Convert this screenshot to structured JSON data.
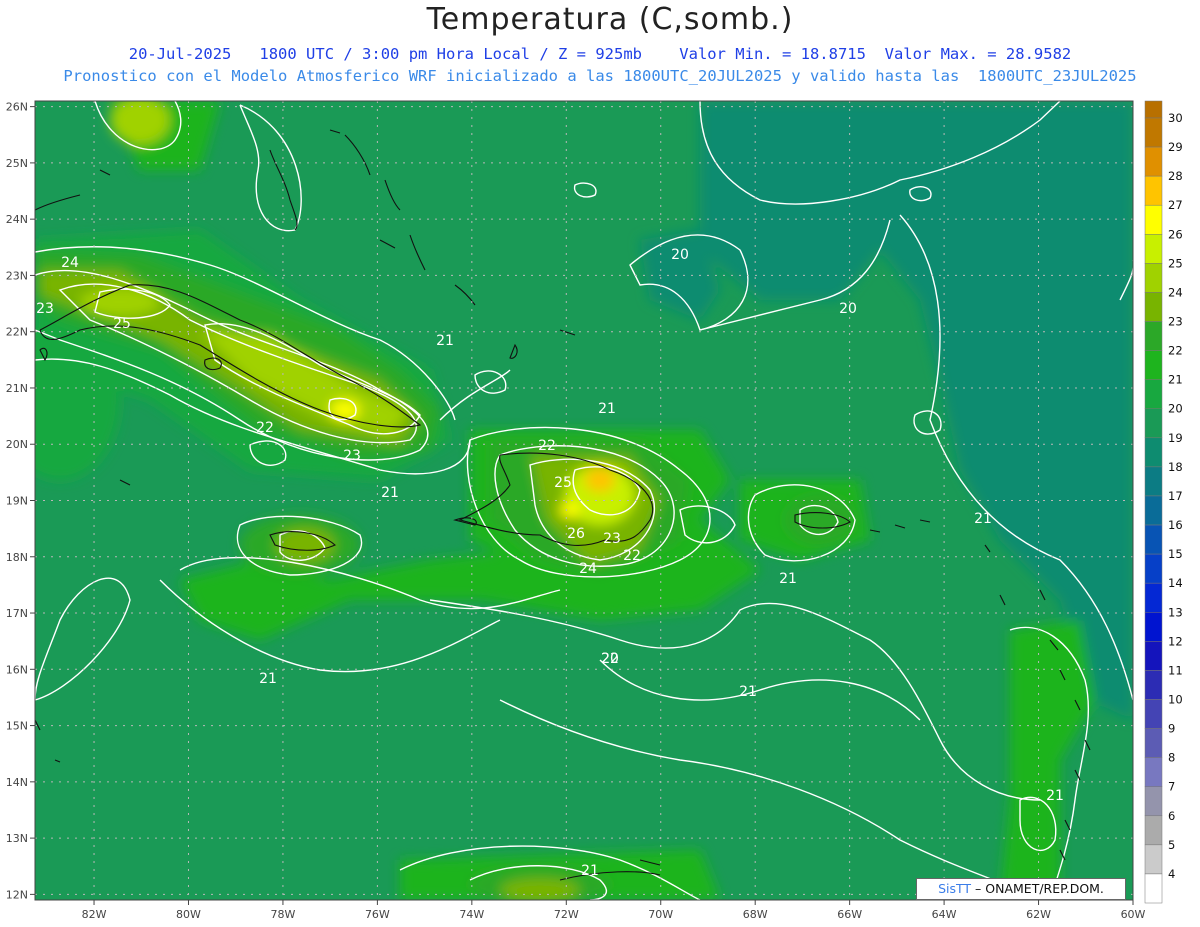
{
  "header": {
    "title": "Temperatura (C,somb.)",
    "subtitle1": "20-Jul-2025   1800 UTC / 3:00 pm Hora Local / Z = 925mb    Valor Min. = 18.8715  Valor Max. = 28.9582",
    "subtitle2": "Pronostico con el Modelo Atmosferico WRF inicializado a las 1800UTC_20JUL2025 y valido hasta las  1800UTC_23JUL2025"
  },
  "map": {
    "lon_range": [
      -83.25,
      -60
    ],
    "lat_range": [
      11.9,
      26.1
    ],
    "lon_ticks": [
      "82W",
      "80W",
      "78W",
      "76W",
      "74W",
      "72W",
      "70W",
      "68W",
      "66W",
      "64W",
      "62W",
      "60W"
    ],
    "lat_ticks": [
      "12N",
      "13N",
      "14N",
      "15N",
      "16N",
      "17N",
      "18N",
      "19N",
      "20N",
      "21N",
      "22N",
      "23N",
      "24N",
      "25N",
      "26N"
    ],
    "value_range": {
      "min": 18.8715,
      "max": 28.9582
    },
    "contour_labels": [
      "24",
      "23",
      "25",
      "21",
      "22",
      "23",
      "21",
      "21",
      "21",
      "20",
      "20",
      "21",
      "22",
      "25",
      "26",
      "23",
      "24",
      "22",
      "21",
      "20",
      "21",
      "21",
      "21",
      "22"
    ]
  },
  "colorbar": {
    "labels": [
      "30",
      "29",
      "28",
      "27",
      "26",
      "25",
      "24",
      "23",
      "22",
      "21",
      "20",
      "19",
      "18",
      "17",
      "16",
      "15",
      "14",
      "13",
      "12",
      "11",
      "10",
      "9",
      "8",
      "7",
      "6",
      "5",
      "4"
    ],
    "colors": [
      "#c07800",
      "#e09000",
      "#ffc400",
      "#ffff00",
      "#c8f000",
      "#a0d200",
      "#78b400",
      "#2ca828",
      "#1eb41e",
      "#18a840",
      "#1a9a56",
      "#0e8c70",
      "#0c7c84",
      "#0a6c98",
      "#0854b4",
      "#0640c8",
      "#0428d4",
      "#0014d0",
      "#1414bc",
      "#2c2cb4",
      "#4444b4",
      "#5c5cb4",
      "#7878c0",
      "#9494ac",
      "#ababab",
      "#cbcbcb",
      "#ffffff"
    ],
    "top_color": "#b87000"
  },
  "credit": {
    "logo": "SisTT",
    "text": "– ONAMET/REP.DOM."
  }
}
